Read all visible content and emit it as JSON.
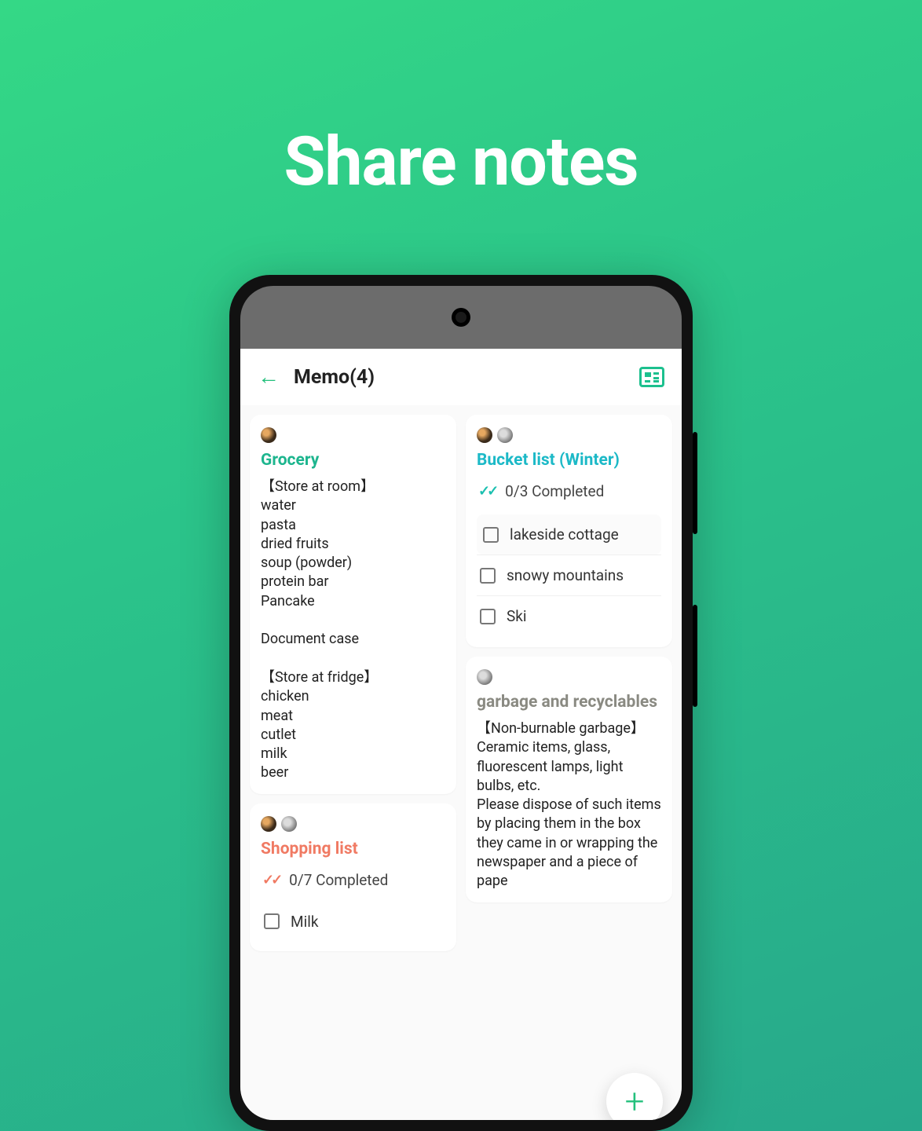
{
  "headline": "Share notes",
  "header": {
    "title": "Memo(4)"
  },
  "fab_label": "+",
  "cards": {
    "grocery": {
      "title": "Grocery",
      "body": "  【Store at room】\nwater\npasta\ndried fruits\nsoup (powder)\nprotein bar\nPancake\n\nDocument case\n\n  【Store at fridge】\nchicken\nmeat\ncutlet\nmilk\nbeer"
    },
    "shopping": {
      "title": "Shopping list",
      "progress": "0/7 Completed",
      "items": [
        "Milk"
      ]
    },
    "bucket": {
      "title": "Bucket list (Winter)",
      "progress": "0/3 Completed",
      "items": [
        "lakeside cottage",
        "snowy mountains",
        "Ski"
      ]
    },
    "garbage": {
      "title": "garbage and recyclables",
      "body": "  【Non-burnable garbage】\nCeramic items, glass, fluorescent lamps, light bulbs, etc.\nPlease dispose of such items by placing them in the box they came in or wrapping the newspaper and a piece of pape"
    }
  }
}
